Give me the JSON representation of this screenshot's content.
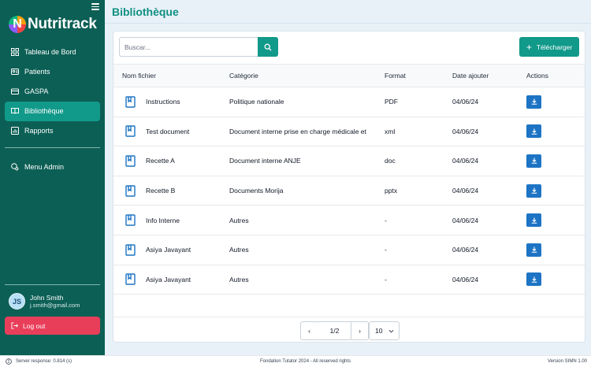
{
  "app": {
    "logo_letter": "N",
    "logo_text": "Nutritrack"
  },
  "sidebar": {
    "items": [
      {
        "label": "Tableau de Bord",
        "icon": "dashboard-icon"
      },
      {
        "label": "Patients",
        "icon": "patients-icon"
      },
      {
        "label": "GASPA",
        "icon": "gaspa-icon"
      },
      {
        "label": "Bibliothèque",
        "icon": "library-icon",
        "active": true
      },
      {
        "label": "Rapports",
        "icon": "reports-icon"
      }
    ],
    "admin_label": "Menu Admin",
    "user": {
      "initials": "JS",
      "name": "John Smith",
      "email": "j.smith@gmail.com"
    },
    "logout_label": "Log out"
  },
  "header": {
    "title": "Bibliothèque"
  },
  "toolbar": {
    "search_placeholder": "Buscar...",
    "upload_label": "Télécharger"
  },
  "table": {
    "headers": [
      "Nom fichier",
      "Catégorie",
      "Format",
      "Date ajouter",
      "Actions"
    ],
    "rows": [
      {
        "name": "Instructions",
        "category": "Politique nationale",
        "format": "PDF",
        "date": "04/06/24"
      },
      {
        "name": "Test document",
        "category": "Document interne prise en charge médicale et",
        "format": "xml",
        "date": "04/06/24"
      },
      {
        "name": "Recette A",
        "category": "Document interne ANJE",
        "format": "doc",
        "date": "04/06/24"
      },
      {
        "name": "Recette B",
        "category": "Documents Morija",
        "format": "pptx",
        "date": "04/06/24"
      },
      {
        "name": "Info Interne",
        "category": "Autres",
        "format": "-",
        "date": "04/06/24"
      },
      {
        "name": "Asiya Javayant",
        "category": "Autres",
        "format": "-",
        "date": "04/06/24"
      },
      {
        "name": "Asiya Javayant",
        "category": "Autres",
        "format": "-",
        "date": "04/06/24"
      }
    ]
  },
  "pagination": {
    "prev": "‹",
    "page": "1/2",
    "next": "›",
    "page_size": "10"
  },
  "footer": {
    "server_response": "Server response: 0.814 (s)",
    "copyright": "Fondation Tutator 2024 - All reserved rights",
    "version": "Version SIMN 1.00"
  },
  "colors": {
    "sidebar_bg": "#0c5f55",
    "accent": "#11998a",
    "download": "#1d74c4",
    "logout": "#e83e5a"
  }
}
